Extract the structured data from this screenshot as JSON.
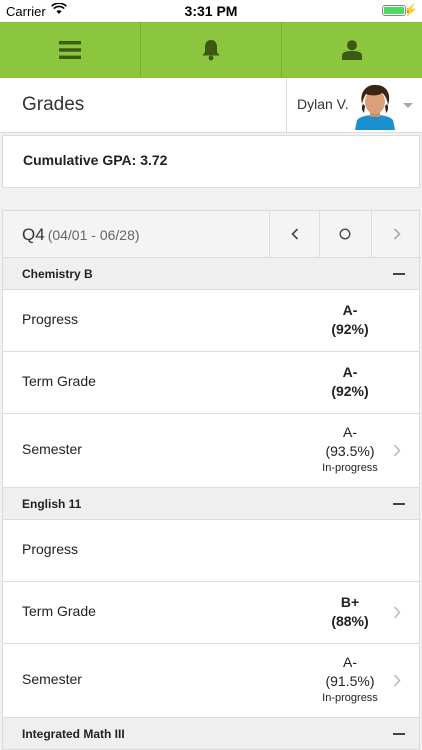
{
  "status_bar": {
    "carrier": "Carrier",
    "time": "3:31 PM"
  },
  "toolbar": {
    "icons": [
      "menu-icon",
      "bell-icon",
      "user-icon"
    ]
  },
  "header": {
    "title": "Grades",
    "user_name": "Dylan V."
  },
  "gpa": {
    "text": "Cumulative GPA: 3.72"
  },
  "term": {
    "label": "Q4",
    "range": "(04/01 - 06/28)"
  },
  "courses": [
    {
      "name": "Chemistry B",
      "rows": [
        {
          "label": "Progress",
          "grade": "A-",
          "percent": "(92%)"
        },
        {
          "label": "Term Grade",
          "grade": "A-",
          "percent": "(92%)"
        },
        {
          "label": "Semester",
          "grade": "A-",
          "percent": "(93.5%)",
          "note": "In-progress"
        }
      ]
    },
    {
      "name": "English 11",
      "rows": [
        {
          "label": "Progress"
        },
        {
          "label": "Term Grade",
          "grade": "B+",
          "percent": "(88%)"
        },
        {
          "label": "Semester",
          "grade": "A-",
          "percent": "(91.5%)",
          "note": "In-progress"
        }
      ]
    },
    {
      "name": "Integrated Math III"
    }
  ],
  "colors": {
    "toolbar": "#8cc63f",
    "toolbar_icon": "#3d5a14"
  }
}
